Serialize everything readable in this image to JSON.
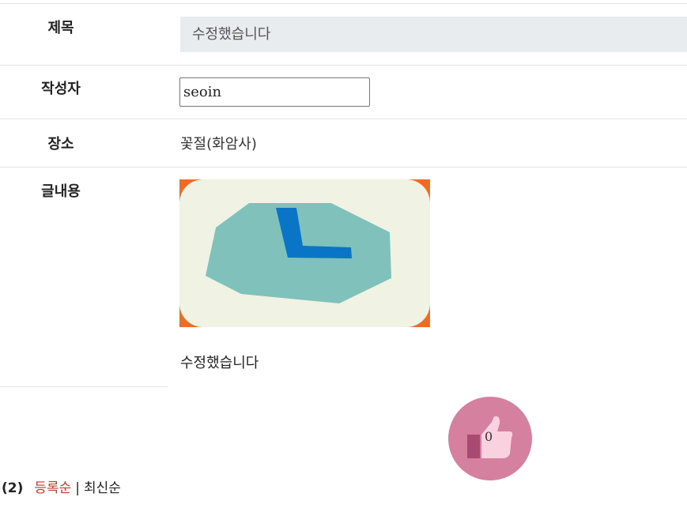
{
  "form": {
    "title": {
      "label": "제목",
      "value": "수정했습니다"
    },
    "author": {
      "label": "작성자",
      "value": "seoin"
    },
    "place": {
      "label": "장소",
      "value": "꽃절(화암사)"
    },
    "content": {
      "label": "글내용",
      "text": "수정했습니다",
      "image_icon": "clock-icon"
    }
  },
  "like": {
    "count": "0",
    "icon": "thumbs-up-icon"
  },
  "comments": {
    "count": "(2)",
    "sort_registered": "등록순",
    "separator": "|",
    "sort_latest": "최신순"
  },
  "colors": {
    "like_button": "#d5809f",
    "sort_active": "#c0392b",
    "readonly_field": "#e9ecef",
    "image_border": "#f26b22",
    "image_bg": "#f0f2e3",
    "clock_face": "#80c2bb",
    "clock_hands": "#0a74c7"
  }
}
